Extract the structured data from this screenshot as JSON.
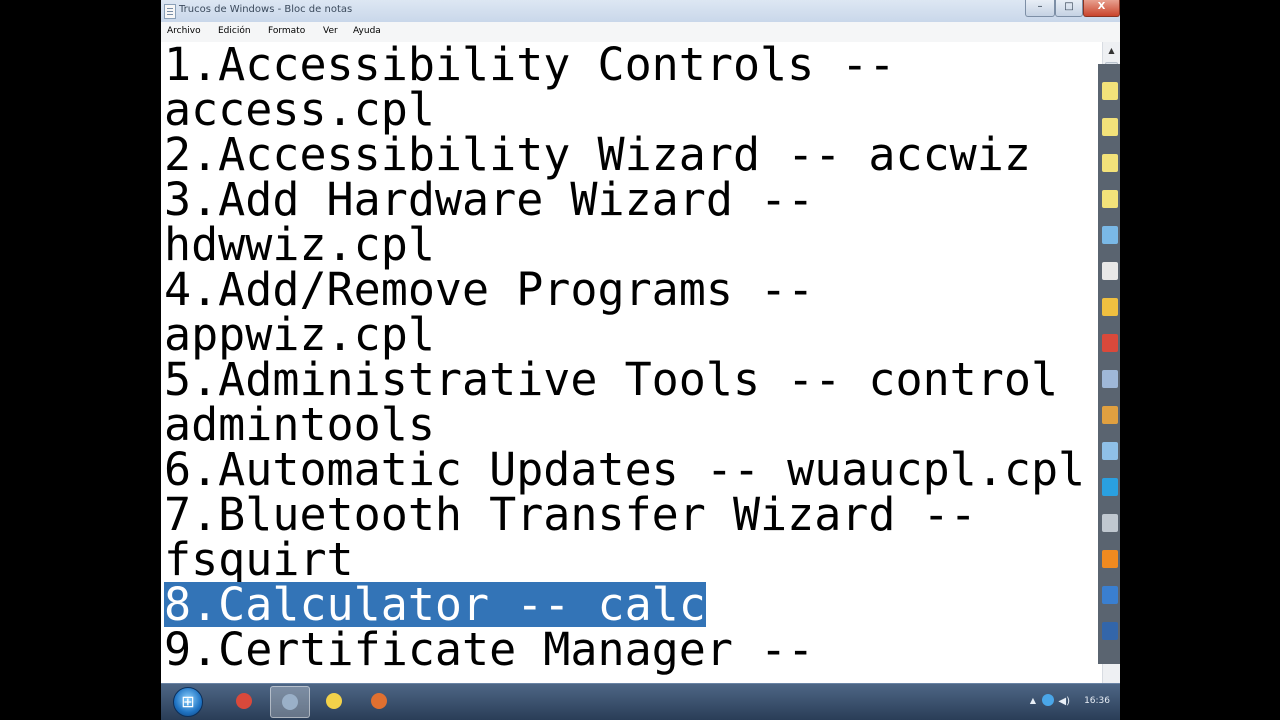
{
  "window": {
    "title": "Trucos de Windows - Bloc de notas",
    "controls": {
      "minimize": "–",
      "maximize": "□",
      "close": "X"
    }
  },
  "menubar": {
    "items": [
      "Archivo",
      "Edición",
      "Formato",
      "Ver",
      "Ayuda"
    ]
  },
  "document": {
    "lines": [
      "1.Accessibility Controls --",
      "access.cpl",
      "2.Accessibility Wizard -- accwiz",
      "3.Add Hardware Wizard --",
      "hdwwiz.cpl",
      "4.Add/Remove Programs --",
      "appwiz.cpl",
      "5.Administrative Tools -- control",
      "admintools",
      "6.Automatic Updates -- wuaucpl.cpl",
      "7.Bluetooth Transfer Wizard --",
      "fsquirt",
      "8.Calculator -- calc",
      "9.Certificate Manager --"
    ],
    "selected_line": "8.Calculator -- calc",
    "selection_color": "#3374b7"
  },
  "side_icons": [
    {
      "icon": "sticky-note-icon",
      "color": "#f3e27a"
    },
    {
      "icon": "sticky-note-icon",
      "color": "#f3e27a"
    },
    {
      "icon": "sticky-note-icon",
      "color": "#f3e27a"
    },
    {
      "icon": "sticky-note-icon",
      "color": "#f3e27a"
    },
    {
      "icon": "computer-icon",
      "color": "#7ab8e6"
    },
    {
      "icon": "cursor-icon",
      "color": "#e8e8e8"
    },
    {
      "icon": "paint-icon",
      "color": "#f0c040"
    },
    {
      "icon": "chrome-icon",
      "color": "#d9493b"
    },
    {
      "icon": "network-icon",
      "color": "#9fb8d8"
    },
    {
      "icon": "tool-icon",
      "color": "#e0a040"
    },
    {
      "icon": "diamond-icon",
      "color": "#8fc0e8"
    },
    {
      "icon": "skype-icon",
      "color": "#2aa0e0"
    },
    {
      "icon": "usb-icon",
      "color": "#c0c8d0"
    },
    {
      "icon": "media-player-icon",
      "color": "#f08a20"
    },
    {
      "icon": "globe-icon",
      "color": "#3a7fd0"
    },
    {
      "icon": "photoshop-icon",
      "color": "#3366aa"
    }
  ],
  "taskbar": {
    "buttons": [
      {
        "icon": "chrome-icon",
        "color": "#d9493b",
        "active": false
      },
      {
        "icon": "notepad-icon",
        "color": "#9ab0c8",
        "active": true
      },
      {
        "icon": "sticky-notes-icon",
        "color": "#f3d24a",
        "active": false
      },
      {
        "icon": "media-icon",
        "color": "#e07030",
        "active": false
      }
    ],
    "tray": {
      "arrow": "▲",
      "volume": "◀)",
      "time": "16:36"
    }
  }
}
